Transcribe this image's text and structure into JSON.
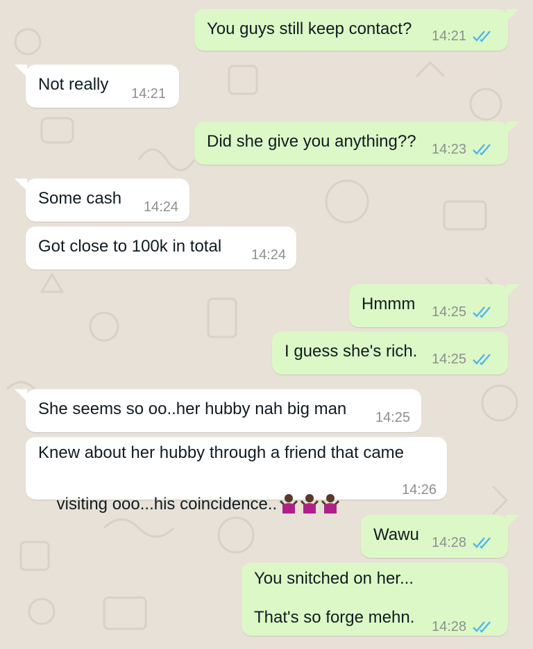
{
  "chat": {
    "colors": {
      "outgoing": "#dcf8c6",
      "incoming": "#ffffff",
      "tick": "#4fb6ec",
      "time": "#8c8f91"
    },
    "messages": [
      {
        "dir": "out",
        "text": "You guys still keep contact?",
        "time": "14:21",
        "status": "read"
      },
      {
        "dir": "in",
        "text": "Not really",
        "time": "14:21"
      },
      {
        "dir": "out",
        "text": "Did she give you anything??",
        "time": "14:23",
        "status": "read"
      },
      {
        "dir": "in",
        "text": "Some cash",
        "time": "14:24"
      },
      {
        "dir": "in",
        "text": "Got close to 100k in total",
        "time": "14:24"
      },
      {
        "dir": "out",
        "text": "Hmmm",
        "time": "14:25",
        "status": "read"
      },
      {
        "dir": "out",
        "text": "I guess she's rich.",
        "time": "14:25",
        "status": "read"
      },
      {
        "dir": "in",
        "text": "She seems so oo..her hubby nah big man",
        "time": "14:25"
      },
      {
        "dir": "in",
        "line1": "Knew about her hubby through a friend that came",
        "line2": "visiting ooo...his coincidence..",
        "emoji": "shrugging-person-emoji x3",
        "time": "14:26"
      },
      {
        "dir": "out",
        "text": "Wawu",
        "time": "14:28",
        "status": "read"
      },
      {
        "dir": "out",
        "line1": "You snitched on her...",
        "line2": "That's so forge mehn.",
        "time": "14:28",
        "status": "read"
      }
    ]
  }
}
